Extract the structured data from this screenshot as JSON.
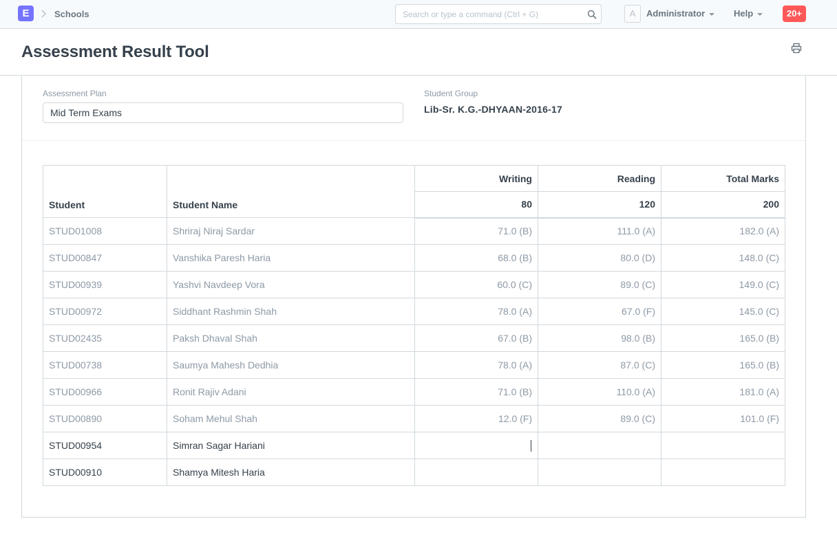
{
  "navbar": {
    "logo_letter": "E",
    "breadcrumb": "Schools",
    "search_placeholder": "Search or type a command (Ctrl + G)",
    "avatar_letter": "A",
    "user": "Administrator",
    "help": "Help",
    "notifications": "20+"
  },
  "page": {
    "title": "Assessment Result Tool"
  },
  "form": {
    "assessment_plan_label": "Assessment Plan",
    "assessment_plan_value": "Mid Term Exams",
    "student_group_label": "Student Group",
    "student_group_value": "Lib-Sr. K.G.-DHYAAN-2016-17"
  },
  "table": {
    "col_student": "Student",
    "col_student_name": "Student Name",
    "col_writing": "Writing",
    "col_reading": "Reading",
    "col_total": "Total Marks",
    "max_writing": "80",
    "max_reading": "120",
    "max_total": "200",
    "rows": [
      {
        "student": "STUD01008",
        "name": "Shriraj Niraj Sardar",
        "writing": "71.0 (B)",
        "reading": "111.0 (A)",
        "total": "182.0 (A)"
      },
      {
        "student": "STUD00847",
        "name": "Vanshika Paresh Haria",
        "writing": "68.0 (B)",
        "reading": "80.0 (D)",
        "total": "148.0 (C)"
      },
      {
        "student": "STUD00939",
        "name": "Yashvi Navdeep Vora",
        "writing": "60.0 (C)",
        "reading": "89.0 (C)",
        "total": "149.0 (C)"
      },
      {
        "student": "STUD00972",
        "name": "Siddhant Rashmin Shah",
        "writing": "78.0 (A)",
        "reading": "67.0 (F)",
        "total": "145.0 (C)"
      },
      {
        "student": "STUD02435",
        "name": "Paksh Dhaval Shah",
        "writing": "67.0 (B)",
        "reading": "98.0 (B)",
        "total": "165.0 (B)"
      },
      {
        "student": "STUD00738",
        "name": "Saumya Mahesh Dedhia",
        "writing": "78.0 (A)",
        "reading": "87.0 (C)",
        "total": "165.0 (B)"
      },
      {
        "student": "STUD00966",
        "name": "Ronit Rajiv Adani",
        "writing": "71.0 (B)",
        "reading": "110.0 (A)",
        "total": "181.0 (A)"
      },
      {
        "student": "STUD00890",
        "name": "Soham Mehul Shah",
        "writing": "12.0 (F)",
        "reading": "89.0 (C)",
        "total": "101.0 (F)"
      },
      {
        "student": "STUD00954",
        "name": "Simran Sagar Hariani",
        "writing": "",
        "reading": "",
        "total": ""
      },
      {
        "student": "STUD00910",
        "name": "Shamya Mitesh Haria",
        "writing": "",
        "reading": "",
        "total": ""
      }
    ]
  },
  "colors": {
    "brand": "#7574ff",
    "badge": "#ff5858",
    "muted_text": "#8d99a6",
    "border": "#d1d8dd"
  }
}
